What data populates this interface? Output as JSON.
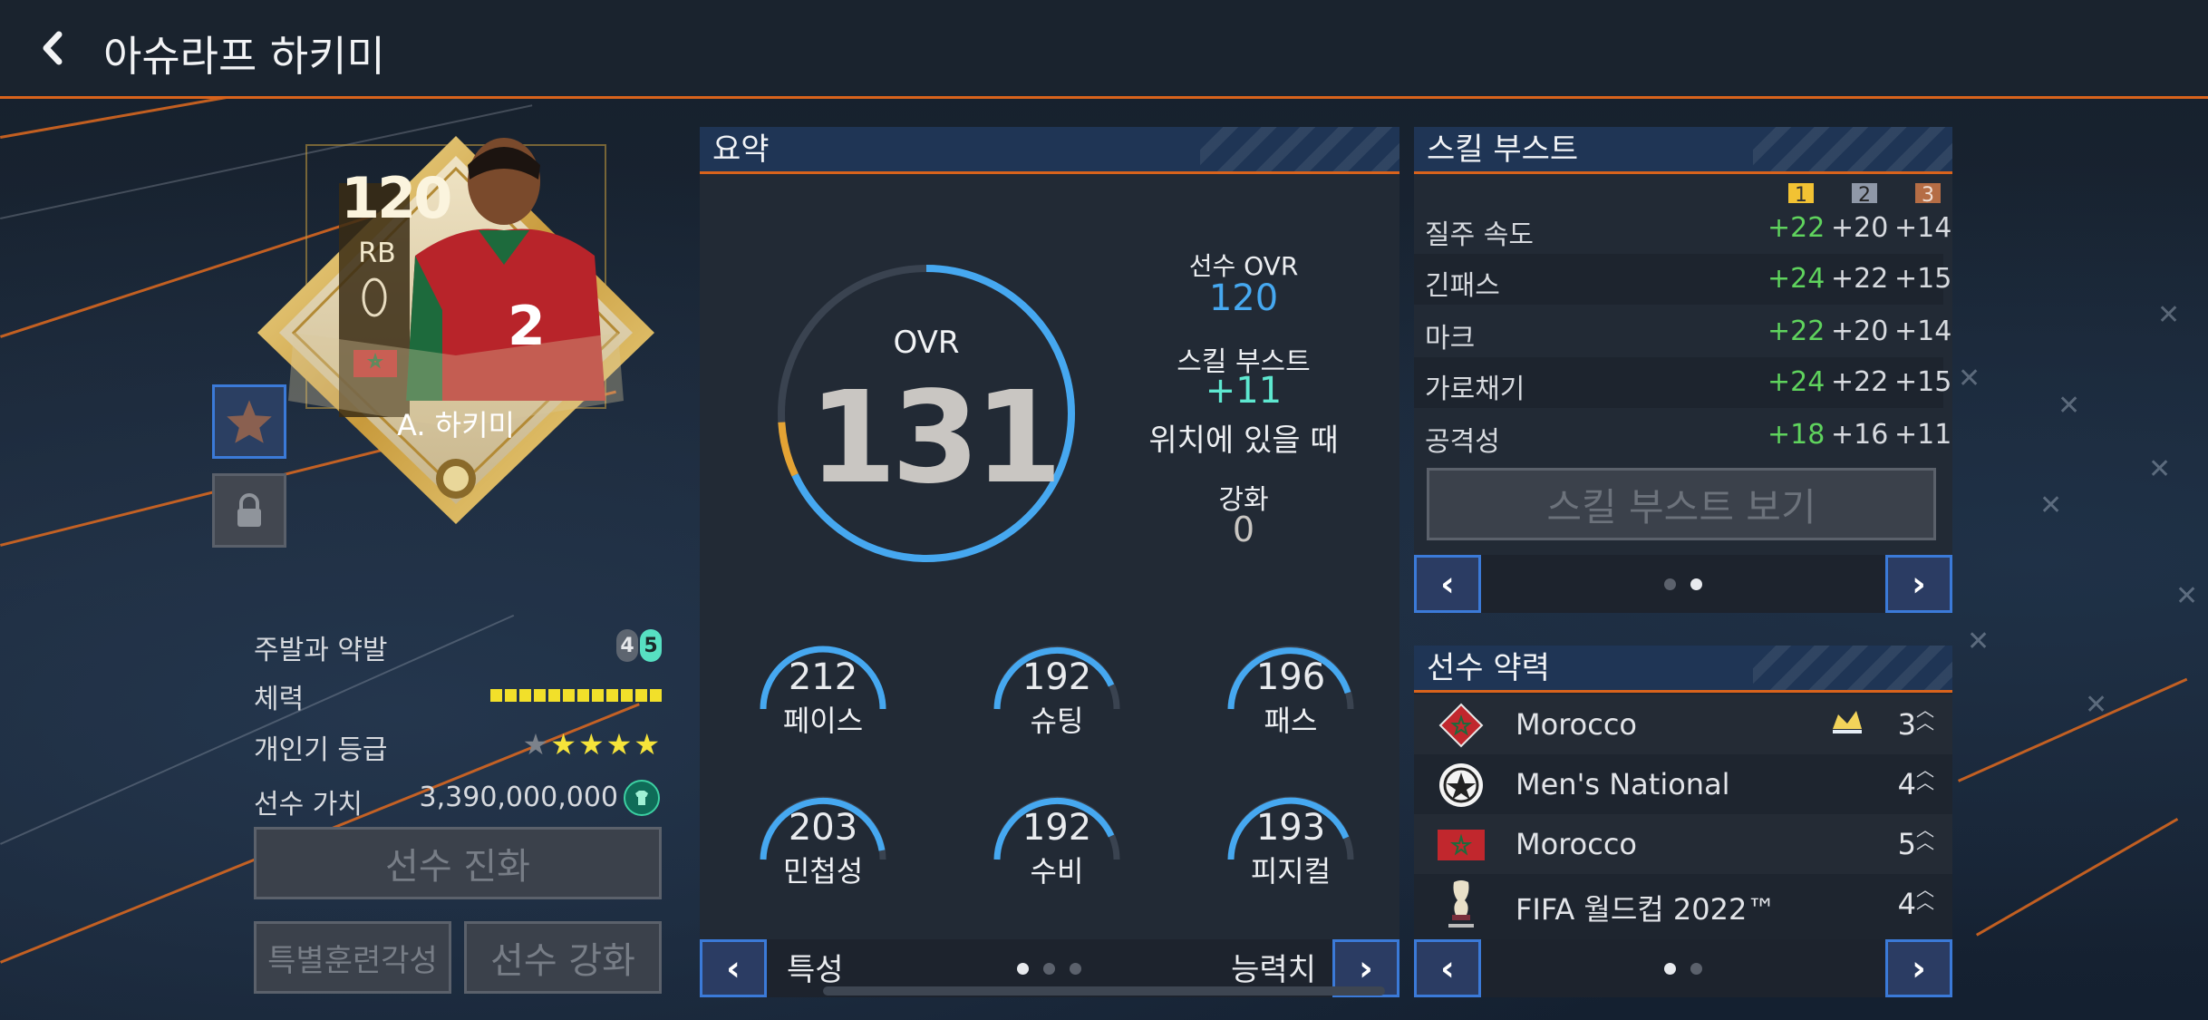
{
  "header": {
    "title": "아슈라프 하키미"
  },
  "player_card": {
    "ovr": "120",
    "position": "RB",
    "name": "A. 하키미"
  },
  "player_info": {
    "foot_label": "주발과 약발",
    "foot_left": "4",
    "foot_right": "5",
    "stamina_label": "체력",
    "popularity_label": "개인기 등급",
    "popularity_stars": "★★★★★",
    "popularity_level": 4,
    "value_label": "선수 가치",
    "value": "3,390,000,000"
  },
  "buttons": {
    "evolve": "선수 진화",
    "special_training": "특별훈련각성",
    "enhance": "선수 강화",
    "skill_boost_view": "스킬 부스트 보기"
  },
  "summary": {
    "title": "요약",
    "ovr_label": "OVR",
    "ovr_value": "131",
    "ovr_fraction": 0.74,
    "player_ovr_label": "선수 OVR",
    "player_ovr": "120",
    "skill_boost_label": "스킬 부스트",
    "skill_boost_value": "+11",
    "position_note": "위치에 있을 때",
    "enhance_label": "강화",
    "enhance_value": "0",
    "stats": [
      {
        "label": "페이스",
        "value": "212"
      },
      {
        "label": "슈팅",
        "value": "192"
      },
      {
        "label": "패스",
        "value": "196"
      },
      {
        "label": "민첩성",
        "value": "203"
      },
      {
        "label": "수비",
        "value": "192"
      },
      {
        "label": "피지컬",
        "value": "193"
      }
    ],
    "footer_left": "특성",
    "footer_right": "능력치"
  },
  "skill_boost": {
    "title": "스킬 부스트",
    "tiers": [
      "1",
      "2",
      "3"
    ],
    "rows": [
      {
        "name": "질주 속도",
        "t1": "+22",
        "t2": "+20",
        "t3": "+14"
      },
      {
        "name": "긴패스",
        "t1": "+24",
        "t2": "+22",
        "t3": "+15"
      },
      {
        "name": "마크",
        "t1": "+22",
        "t2": "+20",
        "t3": "+14"
      },
      {
        "name": "가로채기",
        "t1": "+24",
        "t2": "+22",
        "t3": "+15"
      },
      {
        "name": "공격성",
        "t1": "+18",
        "t2": "+16",
        "t3": "+11"
      }
    ]
  },
  "chemistry": {
    "title": "선수 약력",
    "rows": [
      {
        "name": "Morocco",
        "level": "3"
      },
      {
        "name": "Men's National",
        "level": "4"
      },
      {
        "name": "Morocco",
        "level": "5"
      },
      {
        "name": "FIFA 월드컵 2022™",
        "level": "4"
      }
    ]
  },
  "colors": {
    "accent_orange": "#d9631c",
    "nav_blue": "#3b7ad8",
    "gauge_blue": "#46a8f0",
    "boost_cyan": "#5ee8d0",
    "green": "#5fd35d",
    "star_yellow": "#f5e33a"
  }
}
